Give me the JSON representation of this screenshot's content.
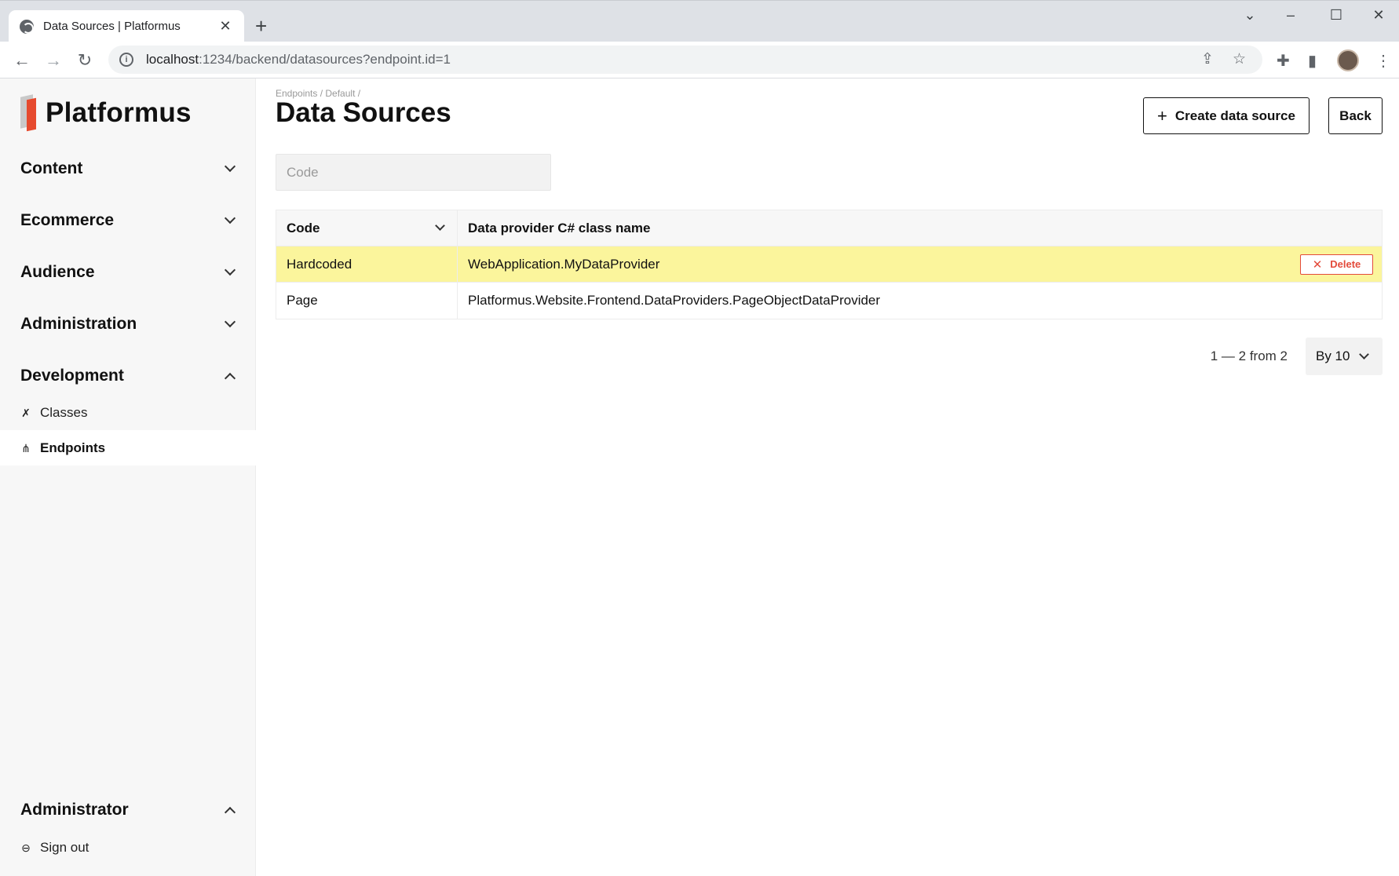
{
  "browser": {
    "tab_title": "Data Sources | Platformus",
    "tab_close": "✕",
    "new_tab": "+",
    "url_host": "localhost",
    "url_rest": ":1234/backend/datasources?endpoint.id=1"
  },
  "sidebar": {
    "logo": "Platformus",
    "groups": [
      {
        "label": "Content"
      },
      {
        "label": "Ecommerce"
      },
      {
        "label": "Audience"
      },
      {
        "label": "Administration"
      },
      {
        "label": "Development"
      }
    ],
    "development_items": [
      {
        "label": "Classes",
        "icon": "classes-icon"
      },
      {
        "label": "Endpoints",
        "icon": "endpoints-icon",
        "active": true
      }
    ],
    "user_group": "Administrator",
    "sign_out": "Sign out"
  },
  "main": {
    "breadcrumb": "Endpoints / Default /",
    "title": "Data Sources",
    "create_button": "Create data source",
    "back_button": "Back",
    "filter_placeholder": "Code",
    "columns": [
      "Code",
      "Data provider C# class name"
    ],
    "rows": [
      {
        "code": "Hardcoded",
        "class_name": "WebApplication.MyDataProvider",
        "highlighted": true,
        "delete_label": "Delete"
      },
      {
        "code": "Page",
        "class_name": "Platformus.Website.Frontend.DataProviders.PageObjectDataProvider",
        "highlighted": false
      }
    ],
    "pager_info": "1 — 2 from 2",
    "page_size": "By 10"
  },
  "colors": {
    "highlight": "#fbf59c",
    "danger": "#e34b3b",
    "logo_accent": "#e64a2e"
  }
}
